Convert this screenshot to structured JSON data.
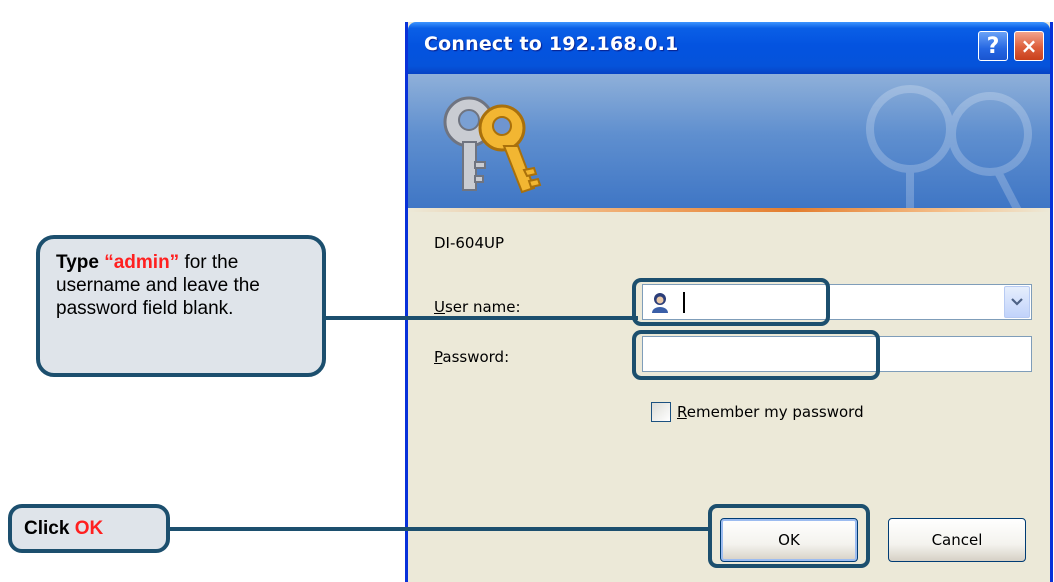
{
  "dialog": {
    "title": "Connect to 192.168.0.1",
    "help_label": "?",
    "close_label": "×",
    "server_name": "DI-604UP",
    "username_label": {
      "accel": "U",
      "rest": "ser name:"
    },
    "password_label": {
      "accel": "P",
      "rest": "assword:"
    },
    "username_value": "",
    "password_value": "",
    "remember_label": {
      "accel": "R",
      "rest": "emember my password"
    },
    "remember_checked": false,
    "ok_label": "OK",
    "cancel_label": "Cancel"
  },
  "callouts": {
    "type": {
      "bold_prefix": "Type",
      "highlight": "“admin”",
      "text": " for the username and leave the password field blank."
    },
    "click": {
      "bold_prefix": "Click",
      "highlight": "OK"
    }
  },
  "colors": {
    "annotation_border": "#1c4f6e",
    "annotation_fill": "#dfe4ea",
    "highlight_text": "#ff2020",
    "titlebar_blue": "#0453e0",
    "dialog_face": "#ece9d8"
  },
  "icons": {
    "banner": "keys-icon",
    "username": "user-icon",
    "dropdown": "chevron-down-icon",
    "help": "help-icon",
    "close": "close-icon"
  }
}
